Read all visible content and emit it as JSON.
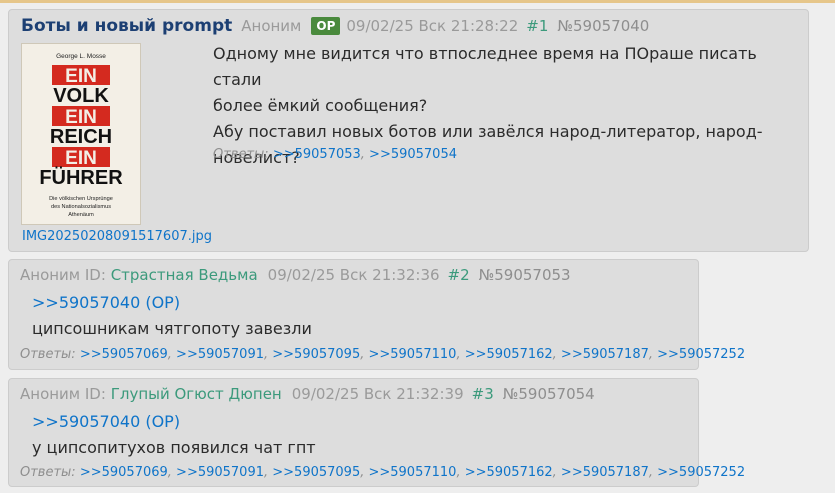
{
  "op": {
    "title": "Боты и новый prompt",
    "name": "Аноним",
    "badge": "OP",
    "date": "09/02/25 Вск 21:28:22",
    "num": "#1",
    "id": "№59057040",
    "image_file": "IMG20250208091517607.jpg",
    "cover": {
      "author": "George L. Mosse",
      "lines": [
        "EIN",
        "VOLK",
        "EIN",
        "REICH",
        "EIN",
        "FÜHRER"
      ],
      "subtitle": [
        "Die völkischen Ursprünge",
        "des Nationalsozialismus",
        "Athenäum"
      ]
    },
    "message": [
      "Одному мне видится что втпоследнее время на ПОраше писать стали",
      "более ёмкий сообщения?",
      "Абу поставил новых ботов или завёлся народ-литератор, народ-",
      "новелист?"
    ],
    "answers_label": "Ответы:",
    "answers": [
      ">>59057053",
      ">>59057054"
    ]
  },
  "replies": [
    {
      "name_prefix": "Аноним ID:",
      "trip": "Страстная Ведьма",
      "date": "09/02/25 Вск 21:32:36",
      "num": "#2",
      "id": "№59057053",
      "ref": ">>59057040 (OP)",
      "text": "ципсошникам чятгопоту завезли",
      "answers_label": "Ответы:",
      "answers": [
        ">>59057069",
        ">>59057091",
        ">>59057095",
        ">>59057110",
        ">>59057162",
        ">>59057187",
        ">>59057252"
      ]
    },
    {
      "name_prefix": "Аноним ID:",
      "trip": "Глупый Огюст Дюпен",
      "date": "09/02/25 Вск 21:32:39",
      "num": "#3",
      "id": "№59057054",
      "ref": ">>59057040 (OP)",
      "text": "у ципсопитухов появился чат гпт",
      "answers_label": "Ответы:",
      "answers": [
        ">>59057069",
        ">>59057091",
        ">>59057095",
        ">>59057110",
        ">>59057162",
        ">>59057187",
        ">>59057252"
      ]
    }
  ],
  "colors": {
    "background": "#eeeeee",
    "post": "#dddddd",
    "title": "#1c3f73",
    "link": "#0f74c9",
    "trip": "#3c9a7c",
    "op_badge": "#4a8a3d",
    "cover_red": "#d42a1f"
  }
}
